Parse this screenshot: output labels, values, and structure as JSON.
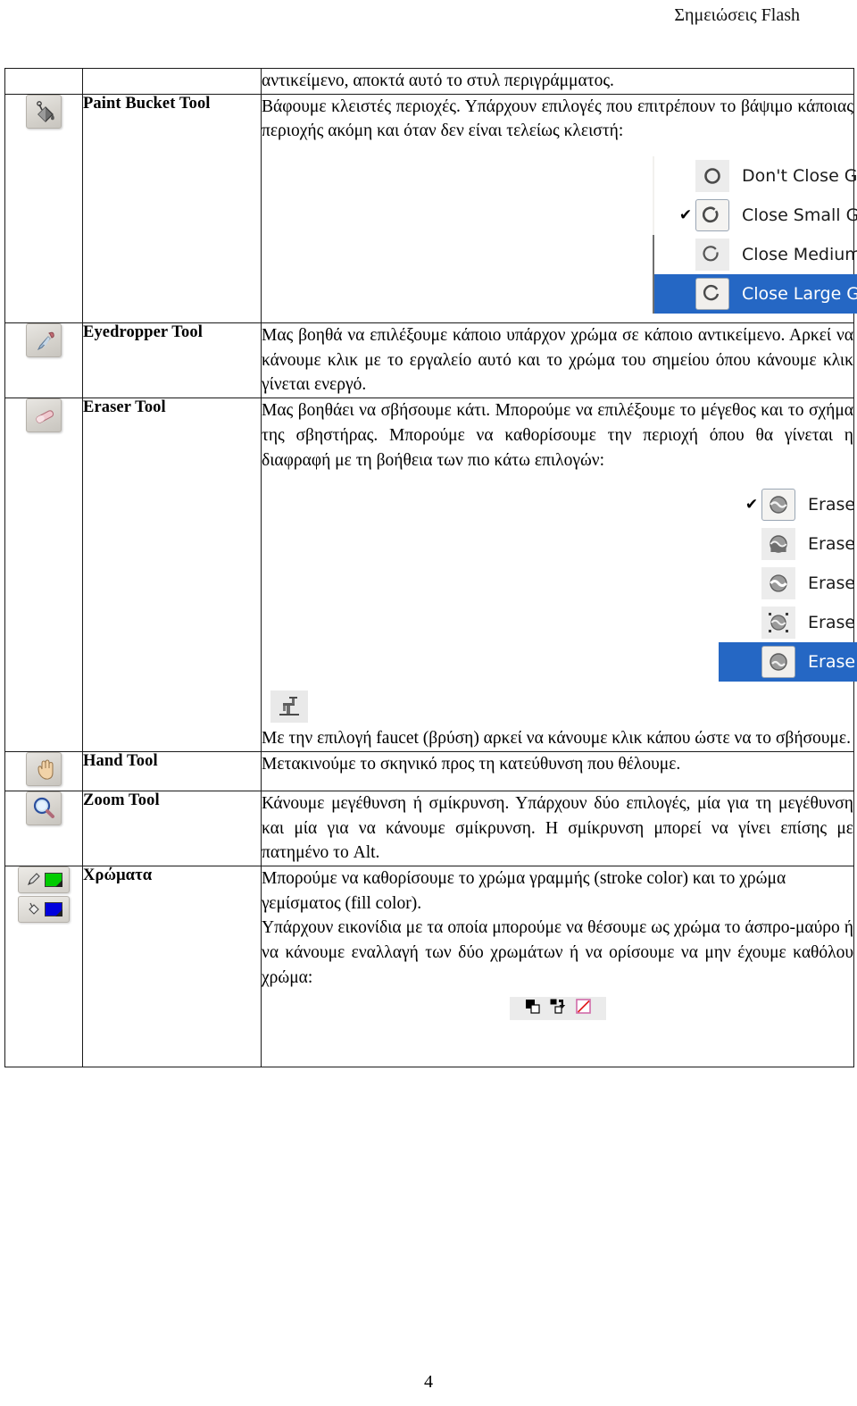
{
  "header": {
    "title": "Σημειώσεις Flash"
  },
  "page": {
    "number": "4"
  },
  "table": {
    "rows": [
      {
        "id": "continuation",
        "icon": "",
        "name": "",
        "paragraphs": [
          "αντικείμενο, αποκτά αυτό το στυλ περιγράμματος."
        ]
      },
      {
        "id": "paint-bucket",
        "icon": "paint-bucket-icon",
        "name": "Paint Bucket Tool",
        "paragraphs": [
          "Βάφουμε κλειστές περιοχές. Υπάρχουν επιλογές που επιτρέπουν το βάψιμο κάποιας περιοχής ακόμη και όταν δεν είναι τελείως κλειστή:"
        ]
      },
      {
        "id": "eyedropper",
        "icon": "eyedropper-icon",
        "name": "Eyedropper Tool",
        "paragraphs": [
          "Μας βοηθά να επιλέξουμε κάποιο υπάρχον χρώμα σε κάποιο αντικείμενο. Αρκεί να κάνουμε κλικ με το εργαλείο αυτό και το χρώμα του σημείου όπου κάνουμε κλικ γίνεται ενεργό."
        ]
      },
      {
        "id": "eraser",
        "icon": "eraser-icon",
        "name": "Eraser Tool",
        "paragraphs": [
          "Μας βοηθάει να  σβήσουμε κάτι. Μπορούμε να επιλέξουμε το μέγεθος και το σχήμα της σβηστήρας. Μπορούμε να καθορίσουμε την περιοχή όπου θα γίνεται η διαφραφή με τη βοήθεια των πιο κάτω επιλογών:"
        ],
        "faucet_text": "Με την επιλογή faucet (βρύση) αρκεί να κάνουμε κλικ κάπου ώστε να το σβήσουμε."
      },
      {
        "id": "hand",
        "icon": "hand-icon",
        "name": "Hand Tool",
        "paragraphs": [
          "Μετακινούμε το σκηνικό προς τη κατεύθυνση που θέλουμε."
        ]
      },
      {
        "id": "zoom",
        "icon": "magnifier-icon",
        "name": "Zoom Tool",
        "paragraphs": [
          "Κάνουμε μεγέθυνση ή σμίκρυνση. Υπάρχουν δύο επιλογές, μία για τη μεγέθυνση και μία για να κάνουμε σμίκρυνση. Η σμίκρυνση μπορεί να γίνει επίσης με πατημένο το Alt."
        ]
      },
      {
        "id": "colors",
        "icon": "stroke-fill-swatches-icon",
        "name": "Χρώματα",
        "paragraphs": [
          "Μπορούμε να καθορίσουμε το χρώμα γραμμής (stroke color) και το χρώμα γεμίσματος (fill color).",
          "Υπάρχουν εικονίδια με τα οποία μπορούμε να θέσουμε ως χρώμα το άσπρο-μαύρο ή να κάνουμε εναλλαγή των δύο χρωμάτων ή να ορίσουμε να μην έχουμε καθόλου χρώμα:"
        ]
      }
    ]
  },
  "gap_menu": {
    "items": [
      {
        "label": "Don't Close Gaps",
        "checked": "",
        "selected": false
      },
      {
        "label": "Close Small Gaps",
        "checked": "✔",
        "selected": false
      },
      {
        "label": "Close Medium Gaps",
        "checked": "",
        "selected": false
      },
      {
        "label": "Close Large Gaps",
        "checked": "",
        "selected": true
      }
    ]
  },
  "eraser_menu": {
    "items": [
      {
        "label": "Erase Normal",
        "checked": "✔",
        "selected": false
      },
      {
        "label": "Erase Fills",
        "checked": "",
        "selected": false
      },
      {
        "label": "Erase Lines",
        "checked": "",
        "selected": false
      },
      {
        "label": "Erase Selected Fills",
        "checked": "",
        "selected": false
      },
      {
        "label": "Erase Inside",
        "checked": "",
        "selected": true
      }
    ]
  },
  "colors": {
    "stroke_swatch": "#00cc00",
    "fill_swatch": "#0000dd",
    "menu_highlight": "#2567c4"
  }
}
